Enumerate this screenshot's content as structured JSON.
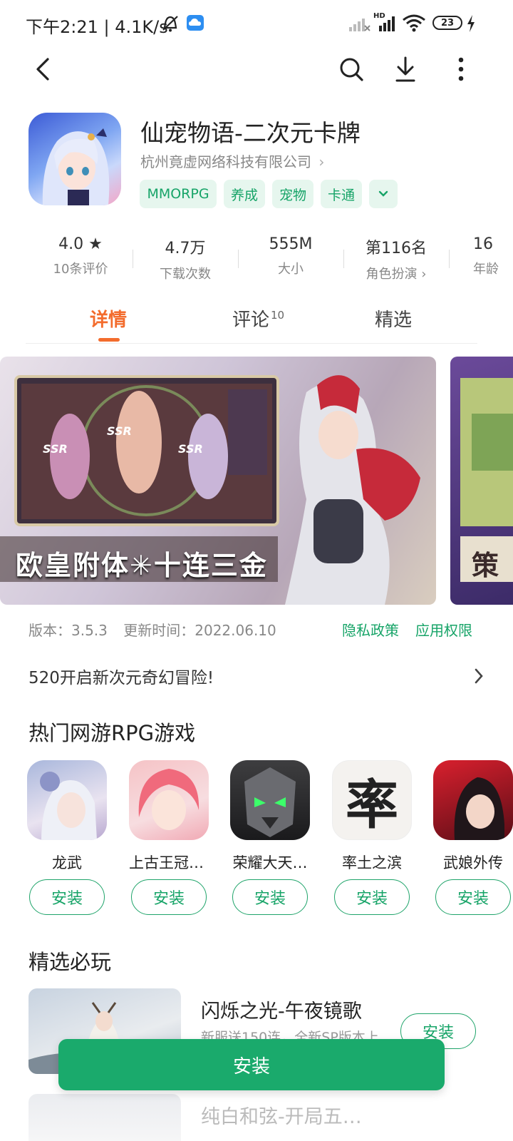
{
  "status_bar": {
    "time_speed": "下午2:21 | 4.1K/s",
    "network_label": "HD",
    "battery": "23"
  },
  "app": {
    "title": "仙宠物语-二次元卡牌",
    "developer": "杭州竟虚网络科技有限公司",
    "developer_chevron": "›",
    "tags": [
      "MMORPG",
      "养成",
      "宠物",
      "卡通"
    ],
    "tags_more": "⌄"
  },
  "stats": [
    {
      "value": "4.0 ★",
      "label": "10条评价"
    },
    {
      "value": "4.7万",
      "label": "下载次数"
    },
    {
      "value": "555M",
      "label": "大小"
    },
    {
      "value": "第116名",
      "label": "角色扮演 ›"
    },
    {
      "value": "16",
      "label": "年龄"
    }
  ],
  "tabs": {
    "details": "详情",
    "reviews": "评论",
    "reviews_count": "10",
    "featured": "精选"
  },
  "screenshots": {
    "banner_text": "欧皇附体✳十连三金",
    "ssr_label": "SSR",
    "second_partial_text": "策"
  },
  "meta": {
    "version": "版本：3.5.3",
    "update_time": "更新时间：2022.06.10",
    "privacy": "隐私政策",
    "permissions": "应用权限"
  },
  "promo": {
    "text": "520开启新次元奇幻冒险!",
    "chevron": "›"
  },
  "hot_section": {
    "title": "热门网游RPG游戏",
    "items": [
      {
        "name": "龙武",
        "button": "安装"
      },
      {
        "name": "上古王冠-…",
        "button": "安装"
      },
      {
        "name": "荣耀大天…",
        "button": "安装"
      },
      {
        "name": "率土之滨",
        "button": "安装",
        "icon_char": "率"
      },
      {
        "name": "武娘外传",
        "button": "安装"
      }
    ]
  },
  "picks": {
    "title": "精选必玩",
    "items": [
      {
        "name": "闪烁之光-午夜镜歌",
        "desc": "新服送150连，全新SP版本上…",
        "button": "安装"
      },
      {
        "name": "纯白和弦-开局五…",
        "desc": "",
        "button": ""
      }
    ]
  },
  "install_button": "安装",
  "colors": {
    "accent_green": "#1aaa6c",
    "tab_active": "#f36c2d"
  }
}
